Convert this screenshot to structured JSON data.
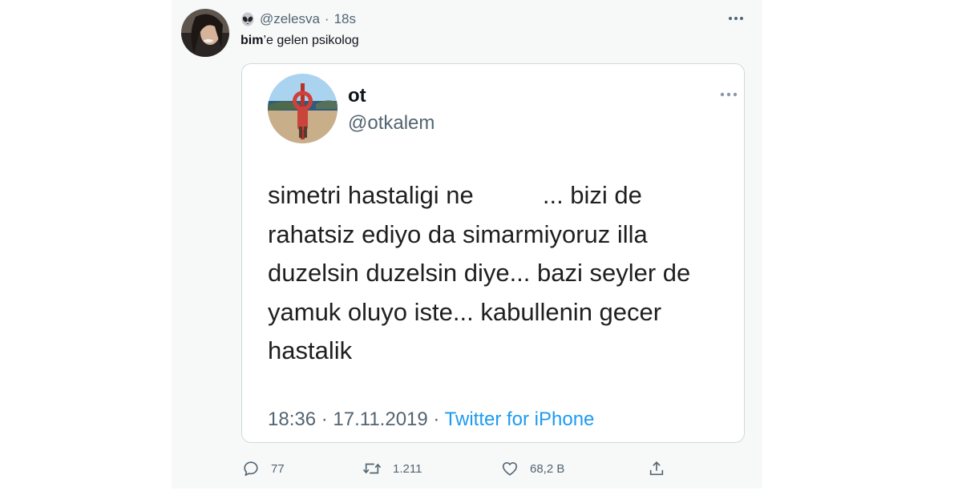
{
  "tweet": {
    "handle": "@zelesva",
    "separator": "·",
    "time": "18s",
    "icon": "alien-emoji-icon",
    "text_bold": "bim",
    "text_rest": "’e gelen psikolog"
  },
  "quoted": {
    "name": "ot",
    "handle": "@otkalem",
    "lines": [
      "simetri hastaligi ne          ... bizi de",
      "rahatsiz ediyo da simarmiyoruz illa",
      "duzelsin duzelsin diye... bazi seyler de",
      "yamuk oluyo iste... kabullenin gecer",
      "hastalik"
    ],
    "time": "18:36",
    "date": "17.11.2019",
    "dot": "·",
    "source": "Twitter for iPhone"
  },
  "actions": {
    "reply_count": "77",
    "retweet_count": "1.211",
    "like_count": "68,2 B"
  },
  "colors": {
    "accent": "#1d9bf0",
    "secondary_text": "#536471",
    "panel_bg": "#f7f9f9"
  }
}
